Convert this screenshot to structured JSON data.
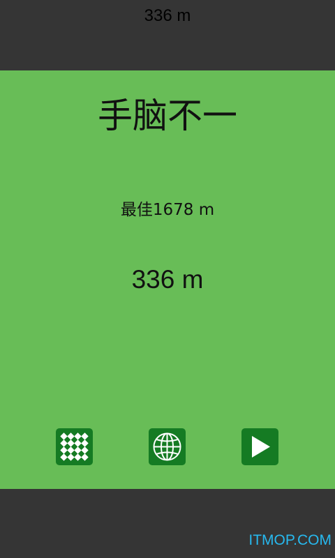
{
  "header": {
    "distance": "336 m"
  },
  "game": {
    "title": "手脑不一",
    "best": "最佳1678 m",
    "current": "336 m"
  },
  "buttons": {
    "grid_icon": "checker-grid-icon",
    "globe_icon": "globe-icon",
    "play_icon": "play-icon"
  },
  "colors": {
    "background": "#353535",
    "panel": "#68bd57",
    "button": "#157b23",
    "watermark": "#27b9ef"
  },
  "watermark": {
    "text": "ITMOP.COM"
  }
}
